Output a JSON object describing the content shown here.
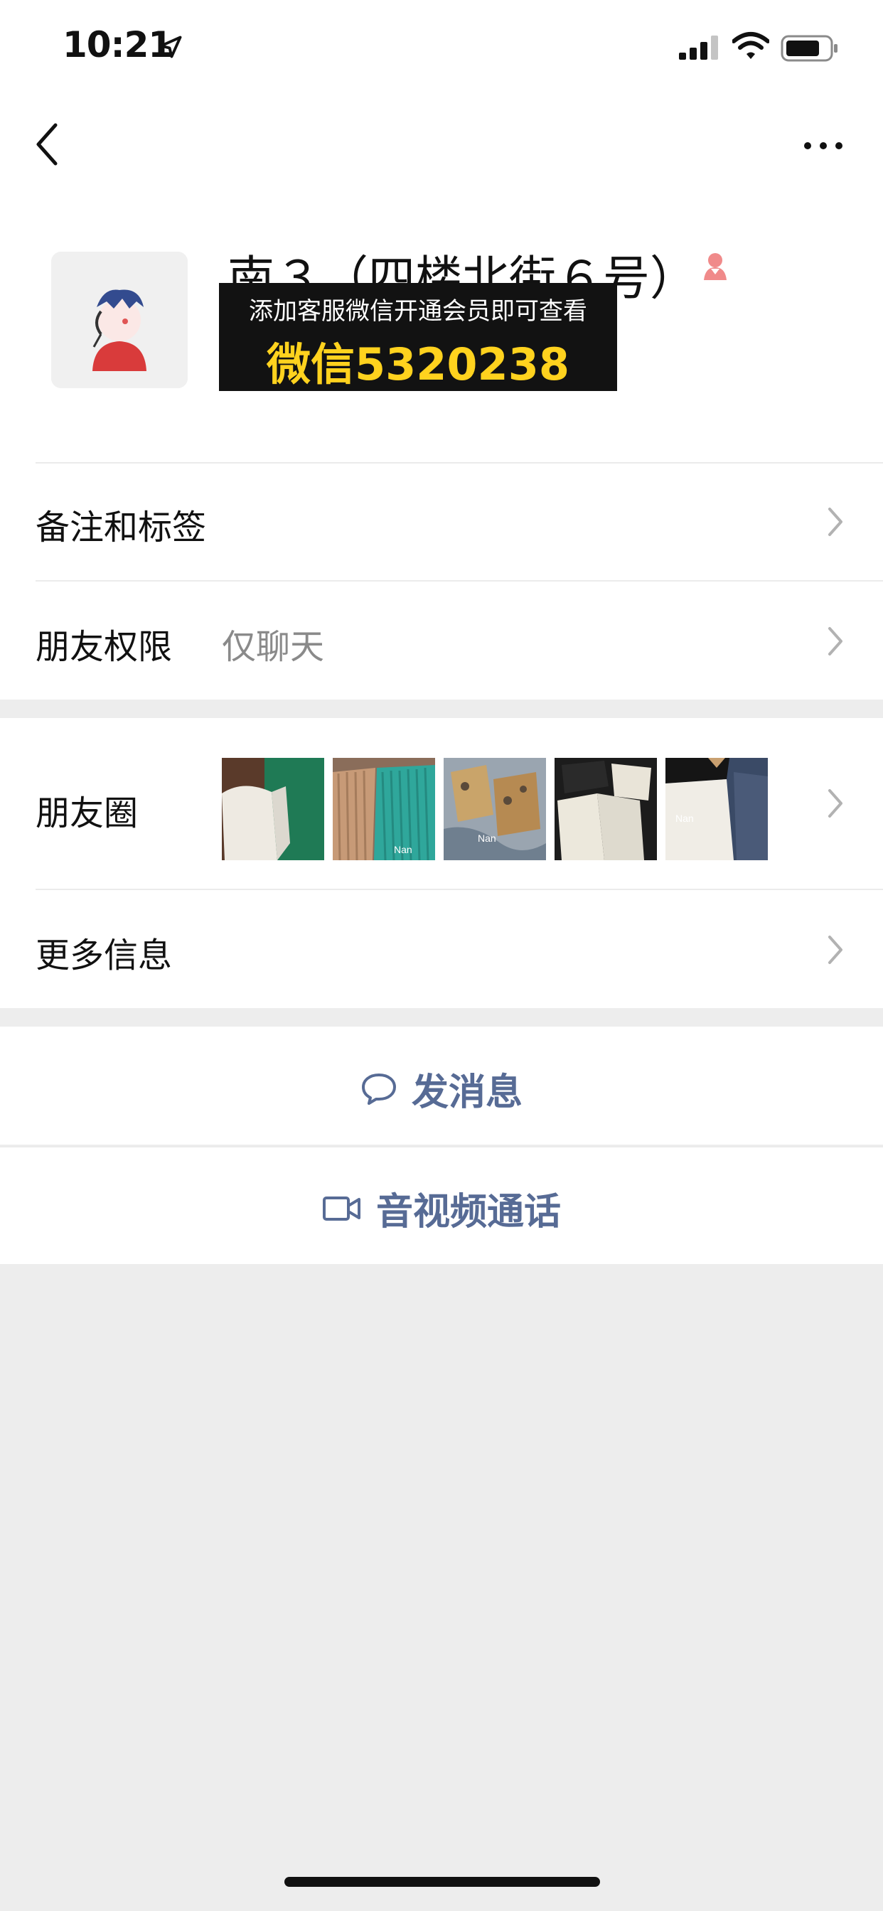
{
  "status_bar": {
    "time": "10:21",
    "icons": [
      "location-arrow-icon",
      "signal-icon",
      "wifi-icon",
      "battery-icon"
    ]
  },
  "nav": {
    "back_icon": "chevron-left-icon",
    "more_icon": "more-dots-icon"
  },
  "profile": {
    "name": "南３（四楼北街６号）",
    "gender_icon": "female-icon",
    "ad_line1": "添加客服微信开通会员即可查看",
    "ad_line2": "微信5320238"
  },
  "rows": {
    "remarks_label": "备注和标签",
    "permission_label": "朋友权限",
    "permission_value": "仅聊天",
    "moments_label": "朋友圈",
    "more_info_label": "更多信息"
  },
  "moments_thumbs": [
    {
      "watermark": ""
    },
    {
      "watermark": "Nan"
    },
    {
      "watermark": "Nan"
    },
    {
      "watermark": ""
    },
    {
      "watermark": "Nan"
    }
  ],
  "actions": {
    "send_message": "发消息",
    "av_call": "音视频通话"
  },
  "colors": {
    "background": "#ededed",
    "link_blue": "#576b95",
    "ad_yellow": "#ffd21e",
    "female_pink": "#f08a8a"
  }
}
